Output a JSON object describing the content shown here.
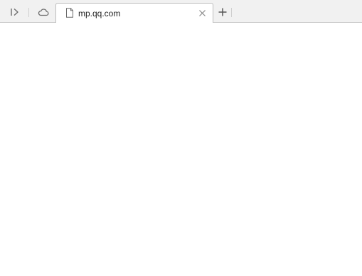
{
  "tabbar": {
    "left_buttons": [
      {
        "name": "sidebar-toggle",
        "icon": "chevron-right-bar-icon"
      },
      {
        "name": "cloud-sync",
        "icon": "cloud-icon"
      }
    ],
    "tabs": [
      {
        "title": "mp.qq.com",
        "icon": "document-icon",
        "active": true,
        "close_icon": "close-icon"
      }
    ],
    "new_tab_icon": "plus-icon"
  },
  "colors": {
    "tabbar_background": "#f1f1f1",
    "tab_border": "#bdbdbd",
    "icon": "#6b6b6b",
    "page_background": "#ffffff"
  }
}
